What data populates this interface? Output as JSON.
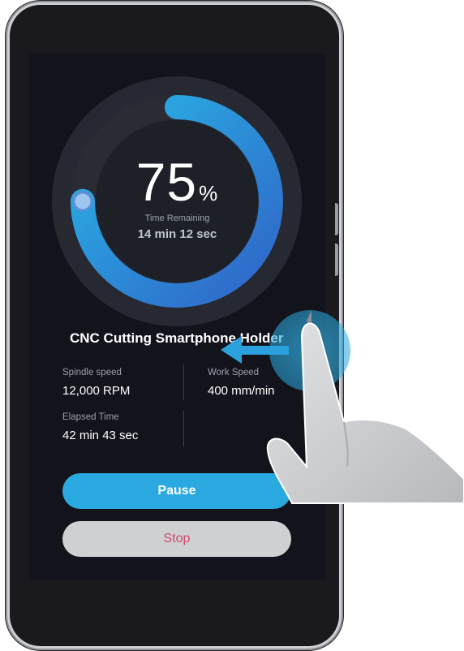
{
  "progress": {
    "percent_value": "75",
    "percent_unit": "%",
    "fraction": 0.75,
    "time_remaining_label": "Time Remaining",
    "time_remaining_value": "14 min 12 sec"
  },
  "job": {
    "title": "CNC Cutting Smartphone Holder"
  },
  "stats": {
    "spindle_speed_label": "Spindle speed",
    "spindle_speed_value": "12,000 RPM",
    "work_speed_label": "Work Speed",
    "work_speed_value": "400 mm/min",
    "elapsed_time_label": "Elapsed Time",
    "elapsed_time_value": "42 min 43 sec"
  },
  "buttons": {
    "pause_label": "Pause",
    "stop_label": "Stop"
  },
  "gesture": {
    "type": "swipe-left",
    "icon": "swipe-left-arrow-icon"
  },
  "colors": {
    "accent": "#2aa9e0",
    "progress_start": "#2f64c8",
    "progress_end": "#29b6e6",
    "stop_text": "#d24b6d",
    "screen_bg": "#13131c"
  }
}
